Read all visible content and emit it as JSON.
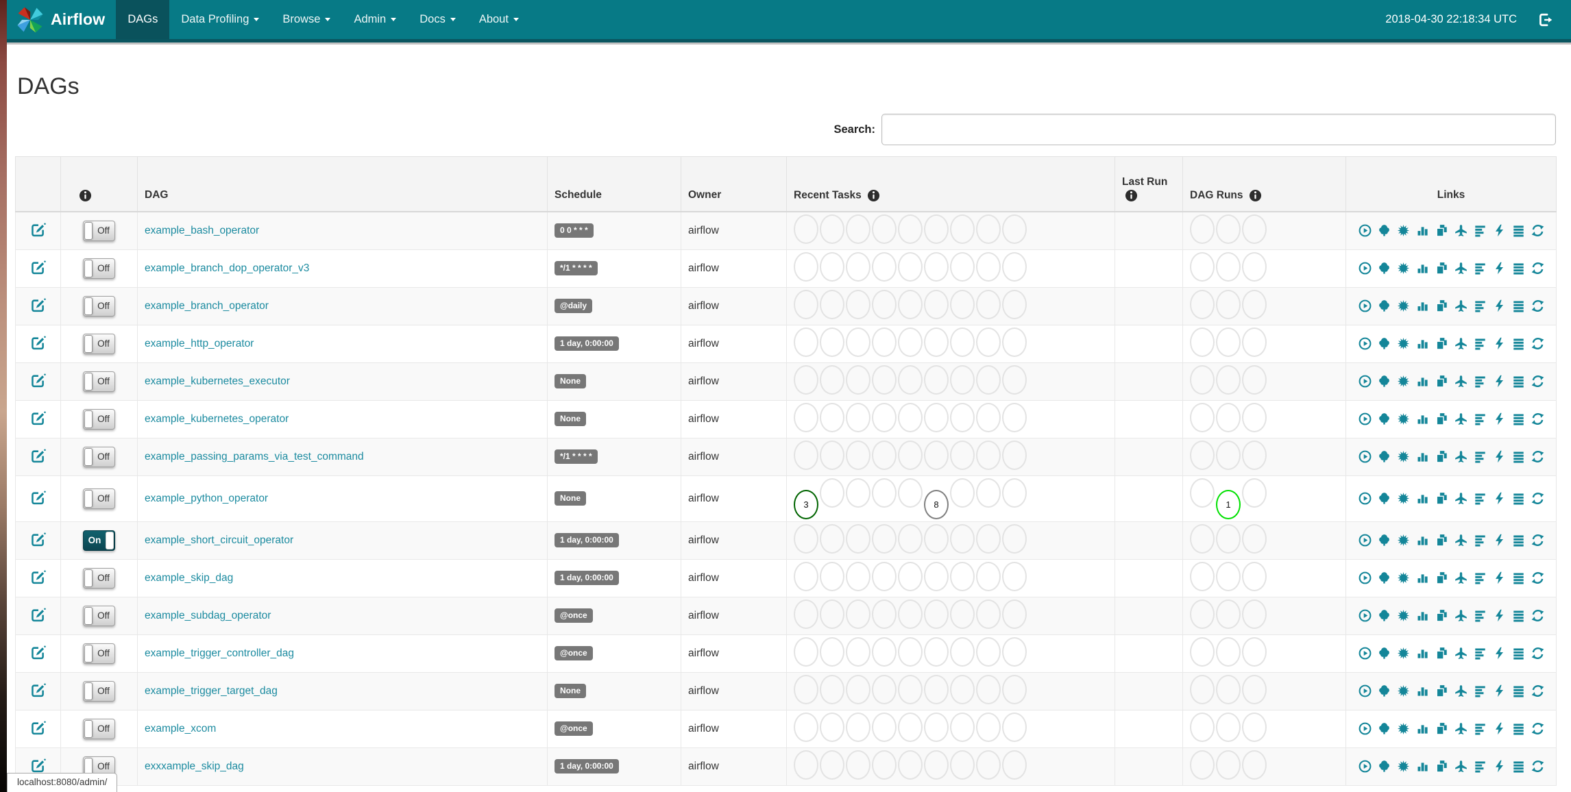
{
  "navbar": {
    "brand": "Airflow",
    "items": [
      {
        "label": "DAGs",
        "active": true,
        "caret": false
      },
      {
        "label": "Data Profiling",
        "active": false,
        "caret": true
      },
      {
        "label": "Browse",
        "active": false,
        "caret": true
      },
      {
        "label": "Admin",
        "active": false,
        "caret": true
      },
      {
        "label": "Docs",
        "active": false,
        "caret": true
      },
      {
        "label": "About",
        "active": false,
        "caret": true
      }
    ],
    "clock": "2018-04-30 22:18:34 UTC"
  },
  "page": {
    "title": "DAGs"
  },
  "search": {
    "label": "Search:",
    "value": ""
  },
  "table": {
    "headers": [
      {
        "label": ""
      },
      {
        "label": "",
        "info": true
      },
      {
        "label": "DAG"
      },
      {
        "label": "Schedule"
      },
      {
        "label": "Owner"
      },
      {
        "label": "Recent Tasks",
        "info": true
      },
      {
        "label": "Last Run",
        "info": true
      },
      {
        "label": "DAG Runs",
        "info": true
      },
      {
        "label": "Links"
      }
    ],
    "recent_slots": 9,
    "run_slots": 3,
    "rows": [
      {
        "toggle": "Off",
        "name": "example_bash_operator",
        "schedule": "0 0 * * *",
        "owner": "airflow"
      },
      {
        "toggle": "Off",
        "name": "example_branch_dop_operator_v3",
        "schedule": "*/1 * * * *",
        "owner": "airflow"
      },
      {
        "toggle": "Off",
        "name": "example_branch_operator",
        "schedule": "@daily",
        "owner": "airflow"
      },
      {
        "toggle": "Off",
        "name": "example_http_operator",
        "schedule": "1 day, 0:00:00",
        "owner": "airflow"
      },
      {
        "toggle": "Off",
        "name": "example_kubernetes_executor",
        "schedule": "None",
        "owner": "airflow"
      },
      {
        "toggle": "Off",
        "name": "example_kubernetes_operator",
        "schedule": "None",
        "owner": "airflow"
      },
      {
        "toggle": "Off",
        "name": "example_passing_params_via_test_command",
        "schedule": "*/1 * * * *",
        "owner": "airflow"
      },
      {
        "toggle": "Off",
        "name": "example_python_operator",
        "schedule": "None",
        "owner": "airflow",
        "recent_tasks": [
          {
            "slot": 0,
            "count": "3",
            "color": "#006400"
          },
          {
            "slot": 5,
            "count": "8",
            "color": "#808080"
          }
        ],
        "dag_runs": [
          {
            "slot": 1,
            "count": "1",
            "color": "#00e000"
          }
        ]
      },
      {
        "toggle": "On",
        "name": "example_short_circuit_operator",
        "schedule": "1 day, 0:00:00",
        "owner": "airflow"
      },
      {
        "toggle": "Off",
        "name": "example_skip_dag",
        "schedule": "1 day, 0:00:00",
        "owner": "airflow"
      },
      {
        "toggle": "Off",
        "name": "example_subdag_operator",
        "schedule": "@once",
        "owner": "airflow"
      },
      {
        "toggle": "Off",
        "name": "example_trigger_controller_dag",
        "schedule": "@once",
        "owner": "airflow"
      },
      {
        "toggle": "Off",
        "name": "example_trigger_target_dag",
        "schedule": "None",
        "owner": "airflow"
      },
      {
        "toggle": "Off",
        "name": "example_xcom",
        "schedule": "@once",
        "owner": "airflow"
      },
      {
        "toggle": "Off",
        "name": "exxxample_skip_dag",
        "schedule": "1 day, 0:00:00",
        "owner": "airflow"
      }
    ]
  },
  "links": [
    {
      "name": "trigger-dag-icon",
      "icon": "i-play-circle"
    },
    {
      "name": "tree-view-icon",
      "icon": "i-tree"
    },
    {
      "name": "graph-view-icon",
      "icon": "i-burst"
    },
    {
      "name": "task-duration-icon",
      "icon": "i-stats"
    },
    {
      "name": "task-tries-icon",
      "icon": "i-copy"
    },
    {
      "name": "landing-times-icon",
      "icon": "i-plane"
    },
    {
      "name": "gantt-view-icon",
      "icon": "i-gantt"
    },
    {
      "name": "code-view-icon",
      "icon": "i-flash"
    },
    {
      "name": "logs-icon",
      "icon": "i-justify"
    },
    {
      "name": "refresh-icon",
      "icon": "i-refresh"
    }
  ],
  "status_bar": {
    "text": "localhost:8080/admin/"
  },
  "colors": {
    "navbar": "#077A86",
    "navbar_active": "#0A525C",
    "link": "#1C8BA0",
    "icon": "#148699",
    "badge_bg": "#777777",
    "task_success": "#006400",
    "task_gray": "#808080",
    "dag_run_running": "#00e000"
  }
}
